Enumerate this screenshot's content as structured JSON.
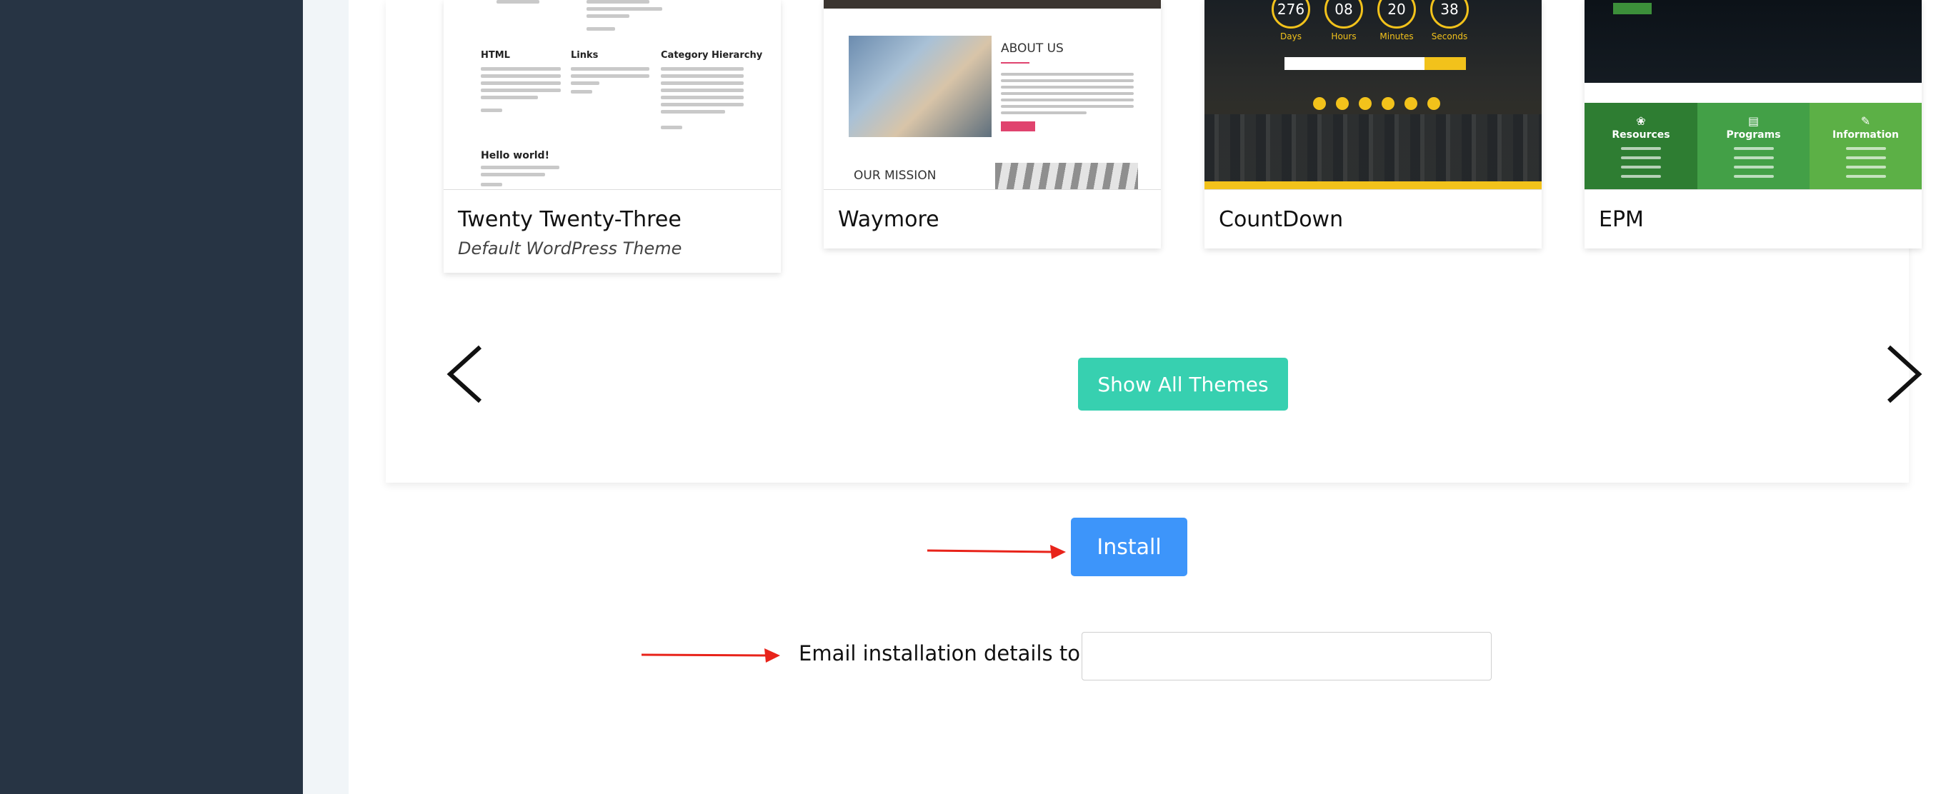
{
  "themes": {
    "cards": [
      {
        "name": "Twenty Twenty-Three",
        "subtitle": "Default WordPress Theme"
      },
      {
        "name": "Waymore"
      },
      {
        "name": "CountDown"
      },
      {
        "name": "EPM"
      }
    ],
    "preview_tt3": {
      "headings": [
        "HTML",
        "Links",
        "Category Hierarchy",
        "Hello world!"
      ]
    },
    "preview_waymore": {
      "about": "ABOUT US",
      "mission": "OUR MISSION"
    },
    "preview_countdown": {
      "values": [
        "276",
        "08",
        "20",
        "38"
      ],
      "labels": [
        "Days",
        "Hours",
        "Minutes",
        "Seconds"
      ]
    },
    "preview_epm": {
      "columns": [
        "Resources",
        "Programs",
        "Information"
      ]
    },
    "show_all_label": "Show All Themes"
  },
  "install": {
    "button_label": "Install",
    "email_label": "Email installation details to :",
    "email_value": ""
  },
  "colors": {
    "sidebar": "#273444",
    "show_all": "#37d0b0",
    "install": "#3d95fa",
    "annotation_arrow": "#e8231a"
  },
  "icons": {
    "prev": "chevron-left-icon",
    "next": "chevron-right-icon"
  }
}
